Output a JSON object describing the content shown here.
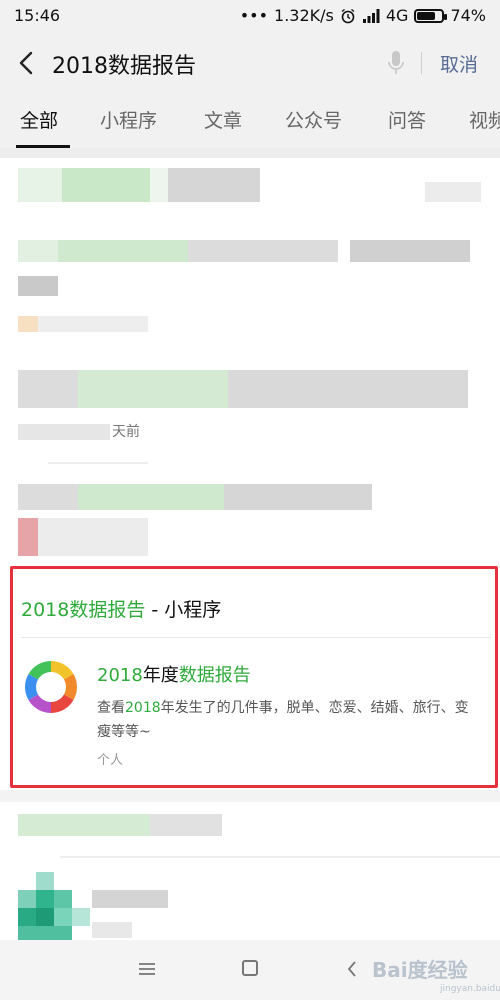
{
  "status_bar": {
    "time": "15:46",
    "signal_dots": "•••",
    "speed": "1.32K/s",
    "network": "4G",
    "battery": "74%",
    "battery_level": 0.74
  },
  "search": {
    "query": "2018数据报告",
    "cancel_label": "取消"
  },
  "tabs": [
    {
      "label": "全部"
    },
    {
      "label": "小程序"
    },
    {
      "label": "文章"
    },
    {
      "label": "公众号"
    },
    {
      "label": "问答"
    },
    {
      "label": "视频"
    }
  ],
  "blurred_results": {
    "visible_fragment": "天前"
  },
  "mini_program_section": {
    "title_highlight": "2018数据报告",
    "title_suffix": " - 小程序",
    "app": {
      "name_prefix": "2018",
      "name_mid": "年度",
      "name_suffix": "数据报告",
      "description_prefix": "查看",
      "description_highlight": "2018",
      "description_rest": "年发生了的几件事，脱单、恋爱、结婚、旅行、变瘦等等~",
      "type_label": "个人"
    },
    "highlight_color": "#2faa3b",
    "frame_color": "#e5313b"
  },
  "watermark": {
    "text": "Bai度经验",
    "sub": "jingyan.baidu.com"
  }
}
